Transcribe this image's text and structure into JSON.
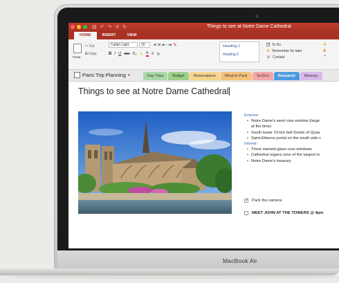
{
  "device": {
    "brand": "MacBook Air"
  },
  "window": {
    "title": "Things to see at Notre Dame Cathedral"
  },
  "ribbon_tabs": [
    {
      "label": "HOME",
      "active": true
    },
    {
      "label": "INSERT",
      "active": false
    },
    {
      "label": "VIEW",
      "active": false
    }
  ],
  "clipboard": {
    "paste_label": "Paste",
    "cut_label": "Cut",
    "copy_label": "Copy"
  },
  "font": {
    "family": "Calibri Light",
    "size": "20"
  },
  "format_buttons": [
    "B",
    "I",
    "U",
    "abc",
    "X₂",
    "A"
  ],
  "styles": {
    "items": [
      "Heading 1",
      "Heading 2"
    ]
  },
  "tags": [
    {
      "label": "To Do",
      "type": "checkbox"
    },
    {
      "label": "Remember for later",
      "type": "star"
    },
    {
      "label": "Contact",
      "type": "contact"
    }
  ],
  "notebook": {
    "name": "Paris Trip Planning"
  },
  "sections": [
    {
      "label": "Day Trips",
      "color": "#a8d8a8",
      "active": false
    },
    {
      "label": "Budget",
      "color": "#9ed08a",
      "active": false
    },
    {
      "label": "Reservations",
      "color": "#f6d58c",
      "active": false
    },
    {
      "label": "What to Pack",
      "color": "#f5c27a",
      "active": false
    },
    {
      "label": "To-Do's",
      "color": "#f3a6a6",
      "active": false
    },
    {
      "label": "Research",
      "color": "#4c9be0",
      "active": true
    },
    {
      "label": "Itinerary",
      "color": "#d8b8e8",
      "active": false
    }
  ],
  "page": {
    "title": "Things to see at Notre Dame Cathedral",
    "exterior_heading": "Exterior:",
    "exterior_items": [
      "Notre Dame's west rose window (large",
      "at the time)",
      "South tower 13-ton bell (home of Quas",
      "Saint-Etienne portal on the south side c"
    ],
    "interior_heading": "Interior:",
    "interior_items": [
      "Three stained-glass rose windows",
      "Cathedral organs (one of the largest in",
      "Notre Dame's treasury"
    ],
    "todos": [
      {
        "label": "Pack the camera",
        "checked": true
      },
      {
        "label": "MEET JOHN AT THE TOWERS @ 4pm",
        "checked": false
      }
    ]
  },
  "colors": {
    "accent": "#a93224",
    "link_blue": "#2b6cb0"
  }
}
